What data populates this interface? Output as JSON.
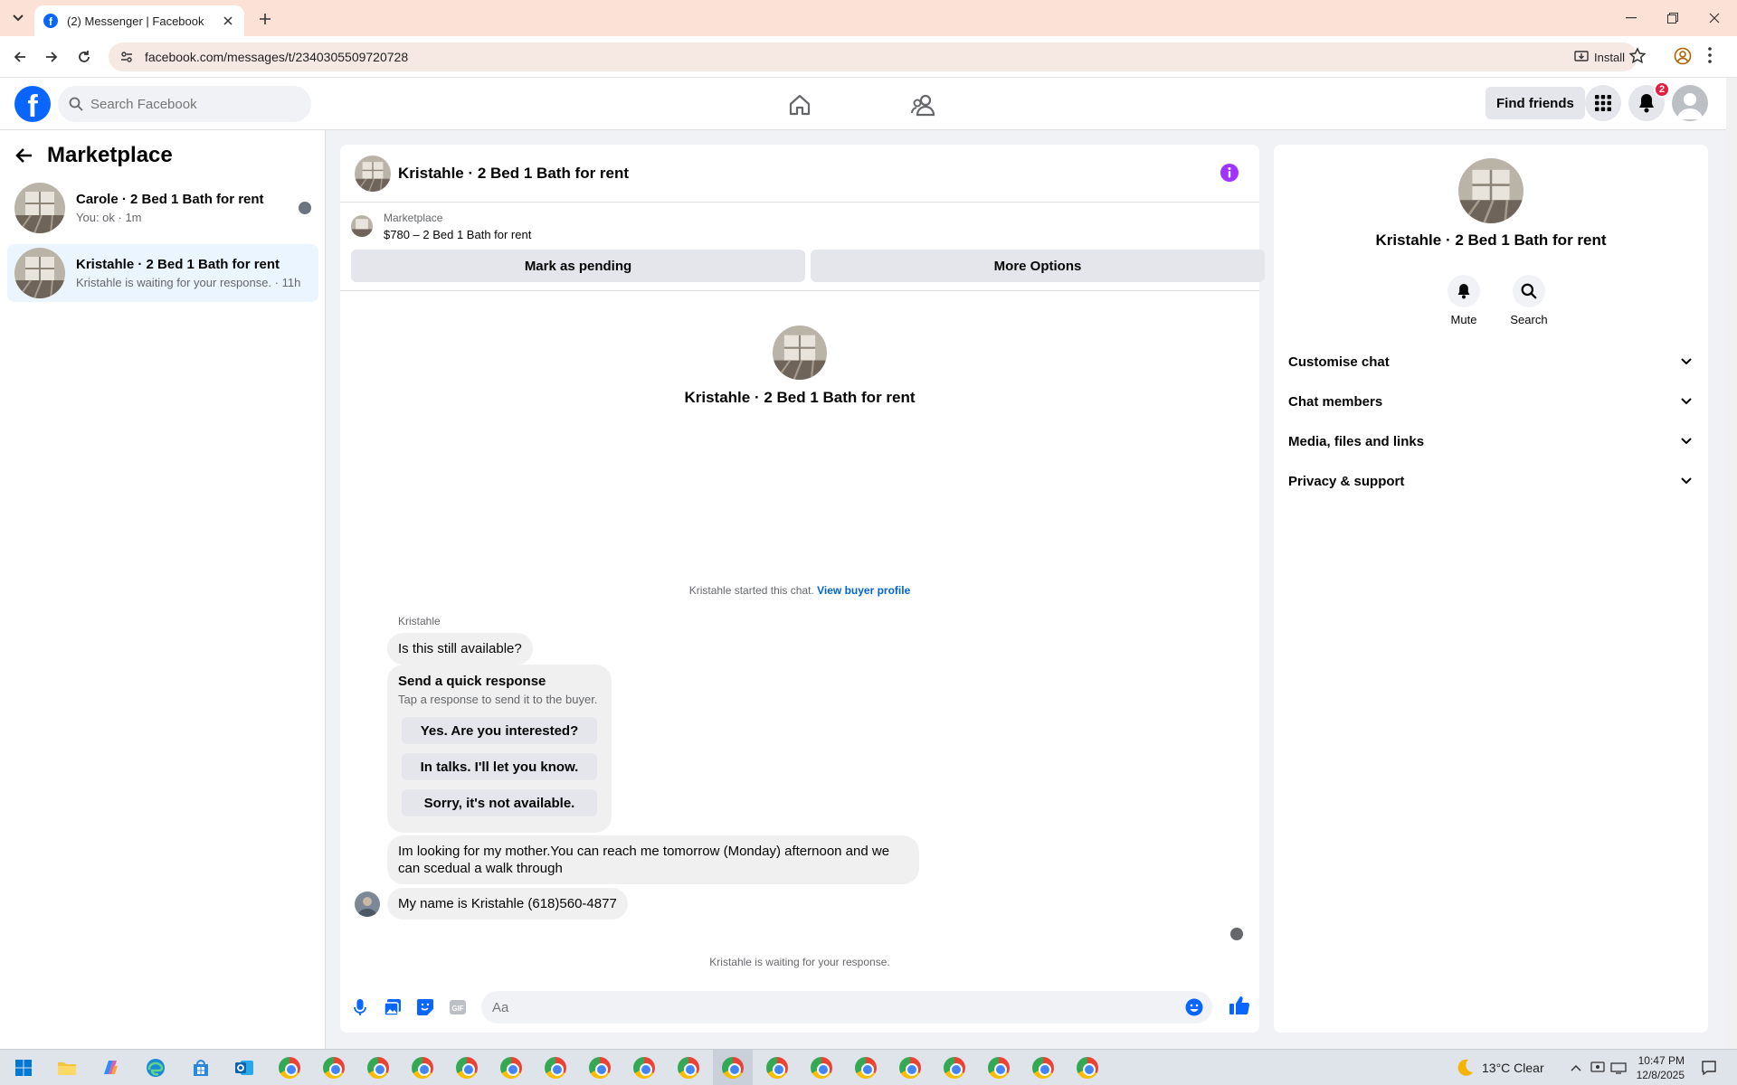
{
  "browser": {
    "tab_title": "(2) Messenger | Facebook",
    "url": "facebook.com/messages/t/2340305509720728",
    "install_label": "Install"
  },
  "fb_header": {
    "logo_letter": "f",
    "search_placeholder": "Search Facebook",
    "find_friends_label": "Find friends",
    "notification_count": "2"
  },
  "sidebar": {
    "title": "Marketplace",
    "chats": [
      {
        "name": "Carole · 2 Bed 1 Bath for rent",
        "preview": "You: ok · 1m"
      },
      {
        "name": "Kristahle · 2 Bed 1 Bath for rent",
        "preview": "Kristahle is waiting for your response. · 11h"
      }
    ]
  },
  "conversation": {
    "title": "Kristahle · 2 Bed 1 Bath for rent",
    "listing_source": "Marketplace",
    "listing_detail": "$780 – 2 Bed 1 Bath for rent",
    "mark_pending_label": "Mark as pending",
    "more_options_label": "More Options",
    "intro_name": "Kristahle · 2 Bed 1 Bath for rent",
    "started_text": "Kristahle started this chat.",
    "view_profile_link": "View buyer profile",
    "sender_name": "Kristahle",
    "messages": [
      "Is this still available?",
      "Im looking for my mother.You can reach me tomorrow (Monday) afternoon and we can scedual a walk through",
      "My name is Kristahle (618)560-4877"
    ],
    "quick_response": {
      "title": "Send a quick response",
      "subtitle": "Tap a response to send it to the buyer.",
      "options": [
        "Yes. Are you interested?",
        "In talks. I'll let you know.",
        "Sorry, it's not available."
      ]
    },
    "waiting_text": "Kristahle is waiting for your response.",
    "composer_placeholder": "Aa"
  },
  "right_panel": {
    "name": "Kristahle · 2 Bed 1 Bath for rent",
    "actions": [
      {
        "label": "Mute",
        "icon": "bell-icon"
      },
      {
        "label": "Search",
        "icon": "search-icon"
      }
    ],
    "sections": [
      "Customise chat",
      "Chat members",
      "Media, files and links",
      "Privacy & support"
    ]
  },
  "taskbar": {
    "weather": "13°C  Clear",
    "time": "10:47 PM",
    "date": "12/8/2025"
  },
  "colors": {
    "accent": "#0866ff",
    "messenger_purple": "#a033ff",
    "tab_bar": "#fbe1d6",
    "badge_red": "#e41e3f"
  }
}
